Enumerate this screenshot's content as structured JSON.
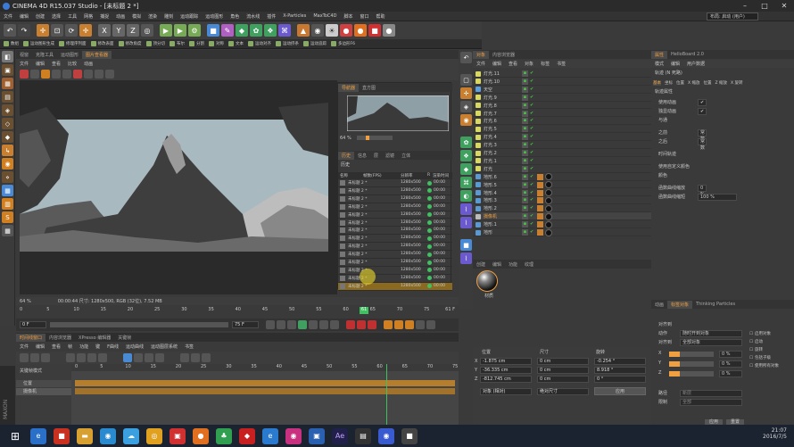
{
  "window": {
    "title": "CINEMA 4D R15.037 Studio - [未标题 2 *]",
    "layout_label": "布局: 启动 (用户)"
  },
  "menubar": [
    "文件",
    "编辑",
    "创建",
    "选择",
    "工具",
    "网格",
    "捕捉",
    "动画",
    "模拟",
    "渲染",
    "雕刻",
    "运动跟踪",
    "运动图形",
    "角色",
    "流水线",
    "插件",
    "X-Particles",
    "MaxToC4D",
    "脚本",
    "窗口",
    "帮助"
  ],
  "toolbar": {
    "icons": [
      "undo-icon",
      "redo-icon",
      "move-icon",
      "scale-icon",
      "rotate-icon",
      "x-axis-icon",
      "y-axis-icon",
      "z-axis-icon",
      "world-icon",
      "render-view-icon",
      "render-icon",
      "render-settings-icon",
      "cube-icon",
      "pen-icon",
      "subdivide-icon",
      "array-icon",
      "nurbs-icon",
      "deform-icon",
      "scene-icon",
      "camera-icon",
      "light-icon"
    ],
    "axis_labels": [
      "X",
      "Y",
      "Z"
    ]
  },
  "pluginbar": [
    "数组",
    "运动图形生成",
    "修理序列面",
    "修改表面",
    "修改角度",
    "顶分切",
    "布尔",
    "分割",
    "对称",
    "文本",
    "运动对齐",
    "运动挤条",
    "运动追踪",
    "多边形F6"
  ],
  "viewport": {
    "tabs": [
      "视窗",
      "克隆工具",
      "运动图形",
      "图片查看器"
    ],
    "menu": [
      "文件",
      "编辑",
      "查看",
      "比较",
      "动画"
    ],
    "status_zoom": "64 %",
    "status_info": "00:00:44  尺寸: 1280x500, RGB (32位), 7.52 MB"
  },
  "render_window": {
    "tabs": [
      "导航器",
      "直方图"
    ],
    "zoom": "64 %",
    "tabs2": [
      "历史",
      "信息",
      "层",
      "滤镜",
      "立体"
    ],
    "history_label": "历史",
    "columns": [
      "名称",
      "帧数(FPS)",
      "分辨率",
      "R",
      "渲染时间"
    ],
    "rows": [
      {
        "name": "未标题 2 *",
        "res": "1280x500",
        "time": "00:00"
      },
      {
        "name": "未标题 2 *",
        "res": "1280x500",
        "time": "00:00"
      },
      {
        "name": "未标题 2 *",
        "res": "1280x500",
        "time": "00:00"
      },
      {
        "name": "未标题 2 *",
        "res": "1280x500",
        "time": "00:00"
      },
      {
        "name": "未标题 2 *",
        "res": "1280x500",
        "time": "00:00"
      },
      {
        "name": "未标题 2 *",
        "res": "1280x500",
        "time": "00:00"
      },
      {
        "name": "未标题 2 *",
        "res": "1280x500",
        "time": "00:00"
      },
      {
        "name": "未标题 2 *",
        "res": "1280x500",
        "time": "00:00"
      },
      {
        "name": "未标题 2 *",
        "res": "1280x500",
        "time": "00:00"
      },
      {
        "name": "未标题 2 *",
        "res": "1280x500",
        "time": "00:00"
      },
      {
        "name": "未标题 2 *",
        "res": "1280x500",
        "time": "00:00"
      },
      {
        "name": "未标题 2 *",
        "res": "1280x500",
        "time": "00:00"
      },
      {
        "name": "未标题 2 *",
        "res": "1280x500",
        "time": "00:00"
      },
      {
        "name": "未标题 2 *",
        "res": "1280x500",
        "time": "00:00"
      }
    ]
  },
  "timeline": {
    "ticks": [
      "0",
      "5",
      "10",
      "15",
      "20",
      "25",
      "30",
      "35",
      "40",
      "45",
      "50",
      "55",
      "60",
      "65",
      "70",
      "75"
    ],
    "current": "61",
    "end": "61 F",
    "start_field": "0 F",
    "end_field": "75 F",
    "frame_field": "0 F",
    "tabs": [
      "时间线窗口",
      "内容浏览器",
      "XPresso 编辑器",
      "关键帧"
    ],
    "menu": [
      "文件",
      "编辑",
      "查看",
      "帧",
      "功能",
      "键",
      "F曲线",
      "运动曲线",
      "运动图层系统",
      "书签"
    ],
    "left_header": "关键帧模式",
    "left_items": [
      "位置",
      "摄像机"
    ],
    "grid_ticks": [
      "0",
      "5",
      "10",
      "15",
      "20",
      "25",
      "30",
      "35",
      "40",
      "45",
      "50",
      "55",
      "60",
      "65",
      "70",
      "75"
    ]
  },
  "object_manager": {
    "tabs": [
      "对象",
      "内容浏览器"
    ],
    "menu": [
      "文件",
      "编辑",
      "查看",
      "对象",
      "标签",
      "书签"
    ],
    "objects": [
      {
        "name": "灯光.11",
        "type": "light"
      },
      {
        "name": "灯光.10",
        "type": "light"
      },
      {
        "name": "天空",
        "type": "sky"
      },
      {
        "name": "灯光.9",
        "type": "light"
      },
      {
        "name": "灯光.8",
        "type": "light"
      },
      {
        "name": "灯光.7",
        "type": "light"
      },
      {
        "name": "灯光.6",
        "type": "light"
      },
      {
        "name": "灯光.5",
        "type": "light"
      },
      {
        "name": "灯光.4",
        "type": "light"
      },
      {
        "name": "灯光.3",
        "type": "light"
      },
      {
        "name": "灯光.2",
        "type": "light"
      },
      {
        "name": "灯光.1",
        "type": "light"
      },
      {
        "name": "灯光",
        "type": "light"
      },
      {
        "name": "地形.6",
        "type": "terrain"
      },
      {
        "name": "地形.5",
        "type": "terrain"
      },
      {
        "name": "地形.4",
        "type": "terrain"
      },
      {
        "name": "地形.3",
        "type": "terrain"
      },
      {
        "name": "地形.2",
        "type": "terrain"
      },
      {
        "name": "摄像机",
        "type": "camera"
      },
      {
        "name": "地形.1",
        "type": "terrain"
      },
      {
        "name": "地形",
        "type": "terrain"
      }
    ]
  },
  "material_manager": {
    "tabs": [
      "创建",
      "编辑",
      "功能",
      "纹理"
    ],
    "material_name": "材质"
  },
  "coordinates": {
    "headers": [
      "位置",
      "尺寸",
      "旋转"
    ],
    "x": {
      "pos": "-1.875 cm",
      "size": "0 cm",
      "rot": "-0.254 °"
    },
    "y": {
      "pos": "-36.335 cm",
      "size": "0 cm",
      "rot": "8.918 °"
    },
    "z": {
      "pos": "-812.745 cm",
      "size": "0 cm",
      "rot": "0 °"
    },
    "mode1": "对象 (相对)",
    "mode2": "绝对尺寸",
    "apply": "应用"
  },
  "attributes": {
    "tabs": [
      "属性",
      "HelloBoard 2.0"
    ],
    "menu": [
      "模式",
      "编辑",
      "用户数据"
    ],
    "title": "轨迹 (N 死路)",
    "subtabs": [
      "基本",
      "坐标",
      "位置",
      "X 缩放",
      "位置",
      "Z 缩放",
      "X 旋转"
    ],
    "section": "轨迹属性",
    "rows": [
      {
        "label": "使用动画",
        "value": "✔"
      },
      {
        "label": "独显动画",
        "value": "✔"
      },
      {
        "label": "与通",
        "value": ""
      },
      {
        "label": "之前",
        "value": "常数"
      },
      {
        "label": "之后",
        "value": "常数"
      },
      {
        "label": "时间轨迹",
        "value": ""
      },
      {
        "label": "使用自定义颜色",
        "value": ""
      },
      {
        "label": "颜色",
        "value": ""
      },
      {
        "label": "函数曲线缩放",
        "value": "0 %"
      },
      {
        "label": "函数曲线缩短",
        "value": "100 %"
      }
    ]
  },
  "attributes2": {
    "tabs": [
      "动画",
      "标签对象",
      "Thinking Particles"
    ],
    "tab_active": "标签对象",
    "section": "对齐到",
    "rows": [
      {
        "label": "动作",
        "value": "随时开到对象"
      },
      {
        "label": "对齐到",
        "value": "全部对象"
      }
    ],
    "checks": [
      "启用对象",
      "启动",
      "旋转",
      "包括子级",
      "使用所有对象"
    ],
    "axes": [
      {
        "label": "X",
        "value": "0 %"
      },
      {
        "label": "Y",
        "value": "0 %"
      },
      {
        "label": "Z",
        "value": "0 %"
      }
    ],
    "bottom_rows": [
      {
        "label": "路径",
        "value": "新层"
      },
      {
        "label": "限制",
        "value": "全部"
      }
    ],
    "buttons": [
      "应用",
      "重置"
    ]
  },
  "taskbar": {
    "time": "21:07",
    "date": "2016/7/5"
  },
  "colors": {
    "accent": "#f0a040",
    "bg": "#3a3a3a",
    "green": "#40c060"
  }
}
